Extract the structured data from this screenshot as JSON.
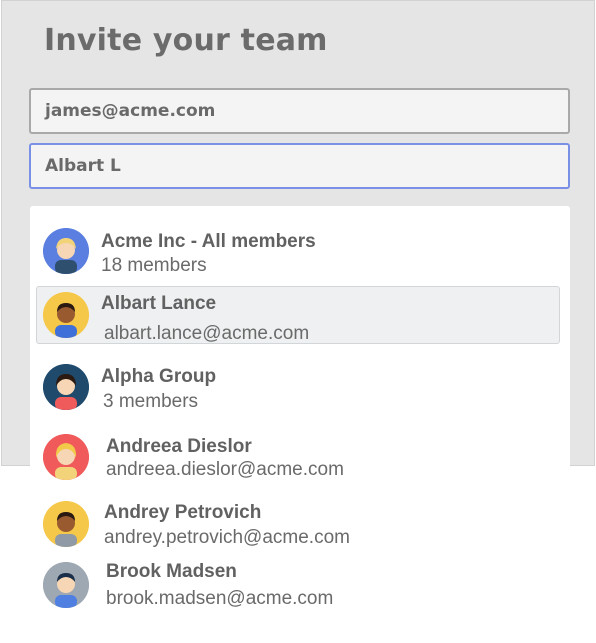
{
  "title": "Invite your team",
  "email_field": {
    "value": "james@acme.com"
  },
  "search_field": {
    "value": "Albart L"
  },
  "results": [
    {
      "name": "Acme  Inc - All members",
      "sub": "18 members",
      "avatar_bg": "#5b7fe0",
      "icon": "team-avatar"
    },
    {
      "name": "Albart Lance",
      "sub": "albart.lance@acme.com",
      "avatar_bg": "#f5c84a",
      "icon": "user-avatar",
      "highlighted": true
    },
    {
      "name": "Alpha Group",
      "sub": "3 members",
      "avatar_bg": "#1f4a6b",
      "icon": "group-avatar"
    },
    {
      "name": "Andreea Dieslor",
      "sub": "andreea.dieslor@acme.com",
      "avatar_bg": "#f05a5a",
      "icon": "user-avatar"
    },
    {
      "name": "Andrey Petrovich",
      "sub": "andrey.petrovich@acme.com",
      "avatar_bg": "#f5c84a",
      "icon": "user-avatar"
    },
    {
      "name": "Brook Madsen",
      "sub": "brook.madsen@acme.com",
      "avatar_bg": "#9ea8b2",
      "icon": "user-avatar"
    }
  ],
  "colors": {
    "panel_bg": "#e5e5e5",
    "focus_border": "#7a8fe6",
    "highlight_bg": "#eef0f1"
  }
}
